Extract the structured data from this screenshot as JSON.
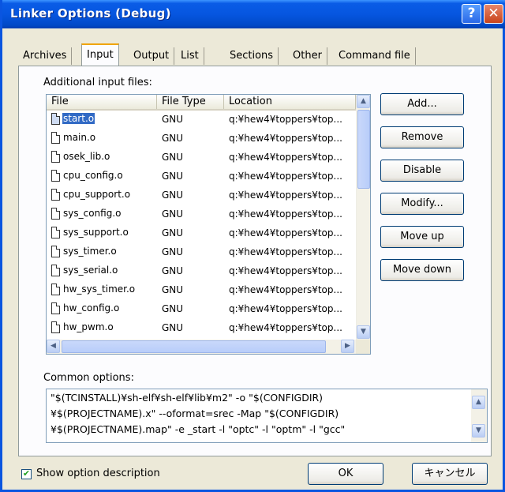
{
  "window": {
    "title": "Linker Options (Debug)"
  },
  "tabs": [
    {
      "label": "Archives",
      "active": false
    },
    {
      "label": "Input",
      "active": true
    },
    {
      "label": "Output",
      "active": false
    },
    {
      "label": "List",
      "active": false
    },
    {
      "label": "Sections",
      "active": false
    },
    {
      "label": "Other",
      "active": false
    },
    {
      "label": "Command file",
      "active": false
    }
  ],
  "input_files": {
    "label": "Additional input files:",
    "columns": [
      "File",
      "File Type",
      "Location"
    ],
    "rows": [
      {
        "file": "start.o",
        "type": "GNU",
        "location": "q:¥hew4¥toppers¥top...",
        "selected": true
      },
      {
        "file": "main.o",
        "type": "GNU",
        "location": "q:¥hew4¥toppers¥top..."
      },
      {
        "file": "osek_lib.o",
        "type": "GNU",
        "location": "q:¥hew4¥toppers¥top..."
      },
      {
        "file": "cpu_config.o",
        "type": "GNU",
        "location": "q:¥hew4¥toppers¥top..."
      },
      {
        "file": "cpu_support.o",
        "type": "GNU",
        "location": "q:¥hew4¥toppers¥top..."
      },
      {
        "file": "sys_config.o",
        "type": "GNU",
        "location": "q:¥hew4¥toppers¥top..."
      },
      {
        "file": "sys_support.o",
        "type": "GNU",
        "location": "q:¥hew4¥toppers¥top..."
      },
      {
        "file": "sys_timer.o",
        "type": "GNU",
        "location": "q:¥hew4¥toppers¥top..."
      },
      {
        "file": "sys_serial.o",
        "type": "GNU",
        "location": "q:¥hew4¥toppers¥top..."
      },
      {
        "file": "hw_sys_timer.o",
        "type": "GNU",
        "location": "q:¥hew4¥toppers¥top..."
      },
      {
        "file": "hw_config.o",
        "type": "GNU",
        "location": "q:¥hew4¥toppers¥top..."
      },
      {
        "file": "hw_pwm.o",
        "type": "GNU",
        "location": "q:¥hew4¥toppers¥top..."
      }
    ]
  },
  "buttons": {
    "add": "Add...",
    "remove": "Remove",
    "disable": "Disable",
    "modify": "Modify...",
    "move_up": "Move up",
    "move_down": "Move down"
  },
  "common_options": {
    "label": "Common options:",
    "lines": [
      "\"$(TCINSTALL)¥sh-elf¥sh-elf¥lib¥m2\" -o \"$(CONFIGDIR)",
      "¥$(PROJECTNAME).x\" --oformat=srec -Map \"$(CONFIGDIR)",
      "¥$(PROJECTNAME).map\" -e _start -l \"optc\" -l \"optm\" -l \"gcc\""
    ]
  },
  "footer": {
    "show_description_label": "Show option description",
    "show_description_checked": true,
    "ok": "OK",
    "cancel": "キャンセル"
  }
}
